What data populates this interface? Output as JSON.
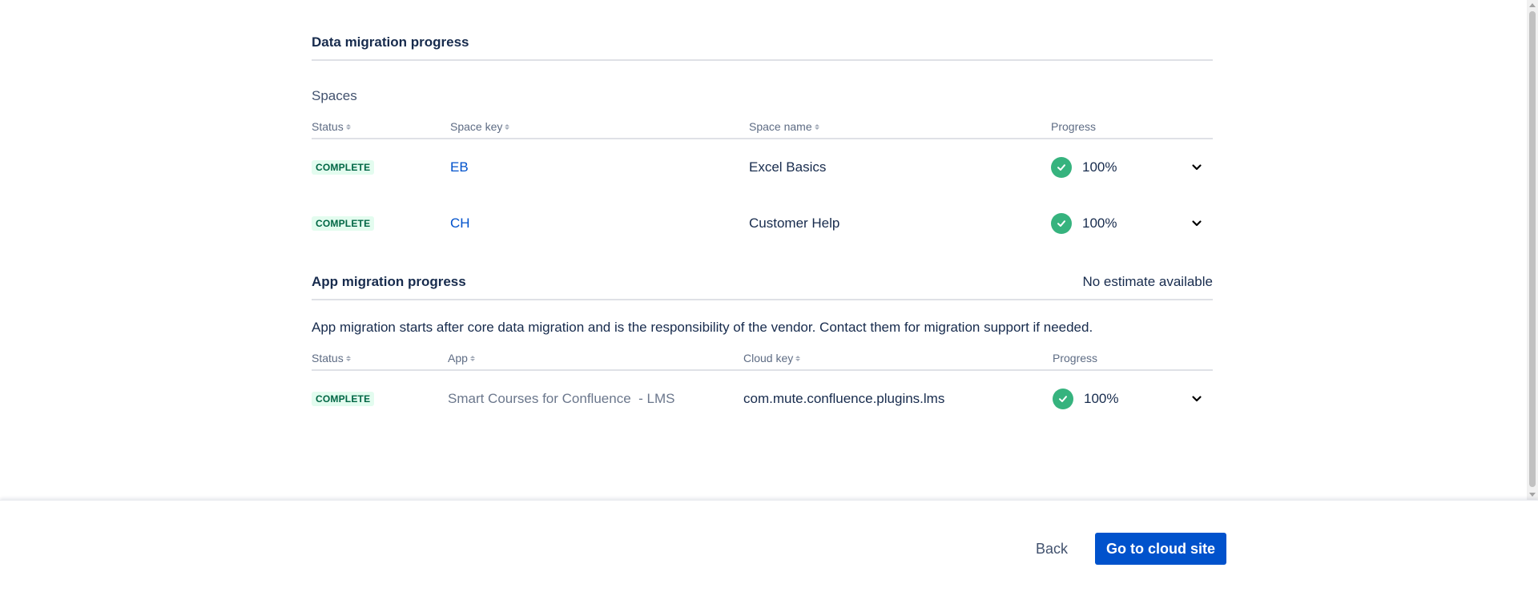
{
  "data_migration": {
    "title": "Data migration progress",
    "subheading": "Spaces",
    "columns": {
      "status": "Status",
      "space_key": "Space key",
      "space_name": "Space name",
      "progress": "Progress"
    },
    "rows": [
      {
        "status": "COMPLETE",
        "space_key": "EB",
        "space_name": "Excel Basics",
        "progress": "100%"
      },
      {
        "status": "COMPLETE",
        "space_key": "CH",
        "space_name": "Customer Help",
        "progress": "100%"
      }
    ]
  },
  "app_migration": {
    "title": "App migration progress",
    "estimate": "No estimate available",
    "description": "App migration starts after core data migration and is the responsibility of the vendor. Contact them for migration support if needed.",
    "columns": {
      "status": "Status",
      "app": "App",
      "cloud_key": "Cloud key",
      "progress": "Progress"
    },
    "rows": [
      {
        "status": "COMPLETE",
        "app": "Smart Courses for Confluence  - LMS",
        "cloud_key": "com.mute.confluence.plugins.lms",
        "progress": "100%"
      }
    ]
  },
  "footer": {
    "back_label": "Back",
    "primary_label": "Go to cloud site"
  },
  "colors": {
    "primary": "#0052CC",
    "success": "#36B37E",
    "badge_bg": "#E3FCEF",
    "badge_text": "#006644",
    "link": "#0052CC"
  },
  "icons": {
    "progress": "check-circle-icon",
    "expand": "chevron-down-icon",
    "sort": "sort-icon"
  }
}
